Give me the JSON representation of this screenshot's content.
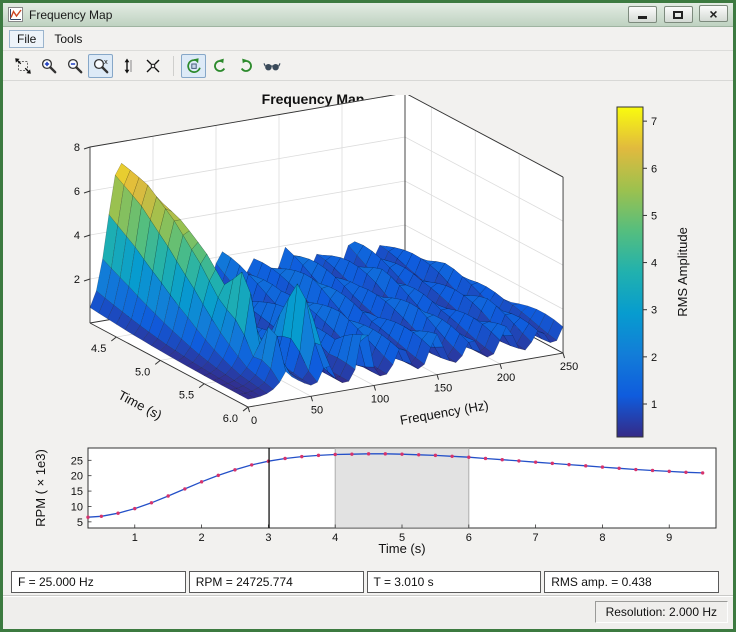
{
  "window": {
    "title": "Frequency Map",
    "controls": [
      {
        "name": "minimize"
      },
      {
        "name": "maximize"
      },
      {
        "name": "close",
        "glyph": "×"
      }
    ],
    "frame_color": "#3c7a40"
  },
  "menu": {
    "items": [
      {
        "label": "File"
      },
      {
        "label": "Tools"
      }
    ]
  },
  "toolbar": {
    "buttons": [
      {
        "icon": "expand-axes",
        "selected": false,
        "group": 1
      },
      {
        "icon": "zoom-in",
        "selected": false,
        "group": 1
      },
      {
        "icon": "zoom-out",
        "selected": false,
        "group": 1
      },
      {
        "icon": "zoom-x",
        "selected": true,
        "group": 1
      },
      {
        "icon": "zoom-y",
        "selected": false,
        "group": 1
      },
      {
        "icon": "restore-view",
        "selected": false,
        "group": 1
      },
      {
        "icon": "rotate-3d",
        "selected": true,
        "group": 2
      },
      {
        "icon": "rotate-counterclockwise",
        "selected": false,
        "group": 2
      },
      {
        "icon": "rotate-clockwise",
        "selected": false,
        "group": 2
      },
      {
        "icon": "stereo-view",
        "selected": false,
        "group": 2
      }
    ]
  },
  "figure": {
    "title": "Frequency Map"
  },
  "chart_data": [
    {
      "type": "surface",
      "title": "Frequency Map",
      "xlabel": "Frequency (Hz)",
      "ylabel": "Time (s)",
      "x_range": [
        0,
        250
      ],
      "y_range": [
        4.2,
        6.0
      ],
      "z_range": [
        0,
        8
      ],
      "x_ticks": [
        0,
        50,
        100,
        150,
        200,
        250
      ],
      "y_ticks": [
        4.5,
        5.0,
        5.5,
        6.0
      ],
      "y_tick_labels": [
        "4.5",
        "5.0",
        "5.5",
        "6.0"
      ],
      "z_ticks": [
        2,
        4,
        6,
        8
      ],
      "colormap": "parula",
      "base": 0.35,
      "caxis": [
        0.3,
        7.3
      ],
      "colorbar": {
        "label": "RMS Amplitude",
        "ticks": [
          1,
          2,
          3,
          4,
          5,
          6,
          7
        ],
        "range": [
          0.3,
          7.3
        ]
      },
      "ridges": [
        {
          "f0": 24,
          "drift": 5,
          "width": 14,
          "amp": [
            [
              4.2,
              6.7
            ],
            [
              4.5,
              6.3
            ],
            [
              4.8,
              5.4
            ],
            [
              5.1,
              4.2
            ],
            [
              5.4,
              2.6
            ],
            [
              5.7,
              1.2
            ],
            [
              6.0,
              0.6
            ]
          ]
        },
        {
          "f0": 30,
          "drift": 0,
          "width": 4,
          "amp": [
            [
              4.2,
              0.0
            ],
            [
              5.3,
              0.3
            ],
            [
              5.55,
              2.8
            ],
            [
              5.7,
              0.4
            ],
            [
              5.85,
              2.2
            ],
            [
              6.0,
              0.4
            ]
          ]
        },
        {
          "f0": 52,
          "drift": 6,
          "width": 6,
          "amp": [
            [
              4.2,
              1.4
            ],
            [
              4.8,
              1.0
            ],
            [
              5.4,
              1.2
            ],
            [
              5.75,
              4.6
            ],
            [
              5.9,
              2.0
            ],
            [
              6.0,
              1.0
            ]
          ]
        },
        {
          "f0": 78,
          "drift": 8,
          "width": 6,
          "amp": [
            [
              4.2,
              1.6
            ],
            [
              4.7,
              1.1
            ],
            [
              5.2,
              1.7
            ],
            [
              5.7,
              1.2
            ],
            [
              6.0,
              2.4
            ]
          ]
        },
        {
          "f0": 104,
          "drift": 10,
          "width": 7,
          "amp": [
            [
              4.2,
              1.9
            ],
            [
              4.8,
              1.3
            ],
            [
              5.4,
              1.6
            ],
            [
              6.0,
              1.2
            ]
          ]
        },
        {
          "f0": 130,
          "drift": 11,
          "width": 7,
          "amp": [
            [
              4.2,
              1.3
            ],
            [
              4.8,
              1.7
            ],
            [
              5.4,
              1.1
            ],
            [
              6.0,
              1.5
            ]
          ]
        },
        {
          "f0": 156,
          "drift": 12,
          "width": 7,
          "amp": [
            [
              4.2,
              1.6
            ],
            [
              4.9,
              1.2
            ],
            [
              5.5,
              1.5
            ],
            [
              6.0,
              1.0
            ]
          ]
        },
        {
          "f0": 182,
          "drift": 13,
          "width": 7,
          "amp": [
            [
              4.2,
              1.1
            ],
            [
              4.8,
              1.5
            ],
            [
              5.4,
              1.0
            ],
            [
              6.0,
              1.3
            ]
          ]
        },
        {
          "f0": 208,
          "drift": 13,
          "width": 7,
          "amp": [
            [
              4.2,
              1.4
            ],
            [
              4.9,
              1.0
            ],
            [
              5.5,
              1.3
            ],
            [
              6.0,
              0.9
            ]
          ]
        },
        {
          "f0": 232,
          "drift": 12,
          "width": 7,
          "amp": [
            [
              4.2,
              1.0
            ],
            [
              4.8,
              1.3
            ],
            [
              5.4,
              0.9
            ],
            [
              6.0,
              1.1
            ]
          ]
        }
      ]
    },
    {
      "type": "line",
      "xlabel": "Time (s)",
      "ylabel": "RPM ( × 1e3)",
      "xlim": [
        0.3,
        9.7
      ],
      "ylim": [
        3,
        29
      ],
      "x_ticks": [
        1,
        2,
        3,
        4,
        5,
        6,
        7,
        8,
        9
      ],
      "y_ticks": [
        5,
        10,
        15,
        20,
        25
      ],
      "cursor_time": 3.01,
      "selection": [
        4.0,
        6.0
      ],
      "line_color": "#2450c8",
      "marker_color": "#d6336c",
      "selection_fill": "#e2e2e2",
      "points": [
        [
          0.3,
          6.5
        ],
        [
          0.5,
          6.8
        ],
        [
          0.75,
          7.8
        ],
        [
          1.0,
          9.3
        ],
        [
          1.25,
          11.2
        ],
        [
          1.5,
          13.4
        ],
        [
          1.75,
          15.7
        ],
        [
          2.0,
          18.0
        ],
        [
          2.25,
          20.1
        ],
        [
          2.5,
          21.9
        ],
        [
          2.75,
          23.5
        ],
        [
          3.0,
          24.7
        ],
        [
          3.25,
          25.6
        ],
        [
          3.5,
          26.2
        ],
        [
          3.75,
          26.6
        ],
        [
          4.0,
          26.9
        ],
        [
          4.25,
          27.0
        ],
        [
          4.5,
          27.1
        ],
        [
          4.75,
          27.1
        ],
        [
          5.0,
          27.0
        ],
        [
          5.25,
          26.8
        ],
        [
          5.5,
          26.6
        ],
        [
          5.75,
          26.3
        ],
        [
          6.0,
          26.0
        ],
        [
          6.25,
          25.6
        ],
        [
          6.5,
          25.2
        ],
        [
          6.75,
          24.8
        ],
        [
          7.0,
          24.4
        ],
        [
          7.25,
          24.0
        ],
        [
          7.5,
          23.6
        ],
        [
          7.75,
          23.2
        ],
        [
          8.0,
          22.8
        ],
        [
          8.25,
          22.4
        ],
        [
          8.5,
          22.0
        ],
        [
          8.75,
          21.7
        ],
        [
          9.0,
          21.4
        ],
        [
          9.25,
          21.1
        ],
        [
          9.5,
          20.9
        ]
      ]
    }
  ],
  "status_bar": {
    "fields": [
      "F = 25.000 Hz",
      "RPM = 24725.774",
      "T = 3.010 s",
      "RMS amp. = 0.438"
    ]
  },
  "status_strip": {
    "resolution": "Resolution: 2.000 Hz"
  }
}
